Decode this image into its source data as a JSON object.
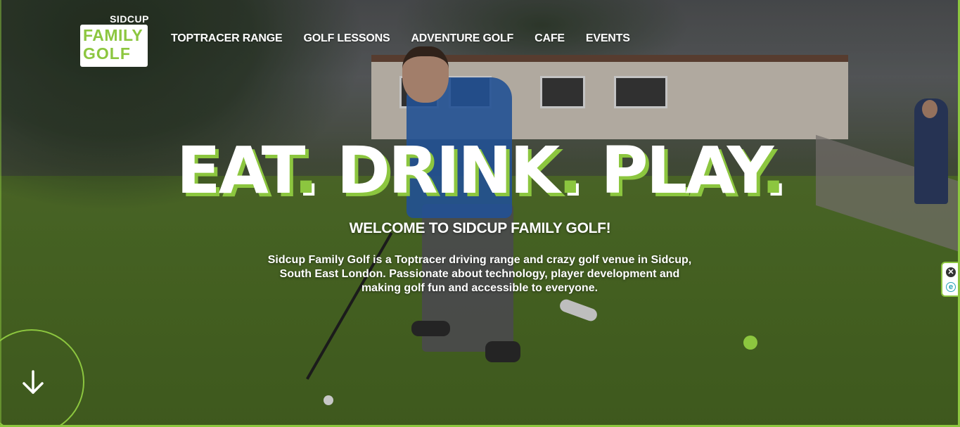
{
  "logo": {
    "top": "SIDCUP",
    "line1": "FAMILY",
    "line2": "GOLF"
  },
  "nav": {
    "items": [
      {
        "label": "TOPTRACER RANGE"
      },
      {
        "label": "GOLF LESSONS"
      },
      {
        "label": "ADVENTURE GOLF"
      },
      {
        "label": "CAFE"
      },
      {
        "label": "EVENTS"
      }
    ]
  },
  "hero": {
    "headline": {
      "w1": "EAT",
      "w2": "DRINK",
      "w3": "PLAY",
      "dot": "."
    },
    "welcome": "WELCOME TO SIDCUP FAMILY GOLF!",
    "intro": "Sidcup Family Golf is a Toptracer driving range and crazy golf venue in Sidcup, South East London. Passionate about technology, player development and making golf fun and accessible to everyone."
  },
  "widget": {
    "close_glyph": "✕",
    "e_glyph": "e"
  },
  "colors": {
    "accent": "#8cc63f",
    "text": "#ffffff"
  }
}
